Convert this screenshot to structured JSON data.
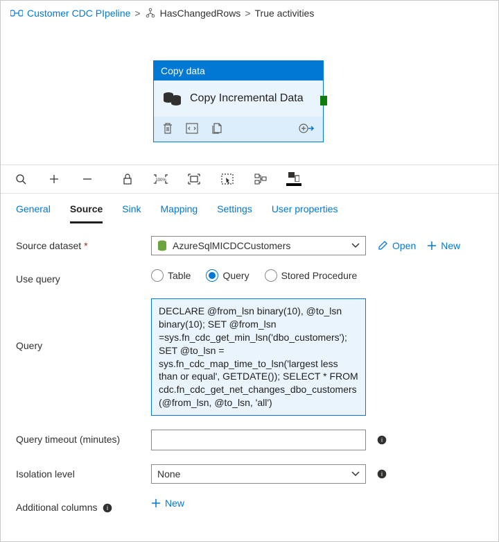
{
  "breadcrumb": {
    "root": "Customer CDC PIpeline",
    "mid": "HasChangedRows",
    "leaf": "True activities"
  },
  "activity": {
    "type": "Copy data",
    "name": "Copy Incremental Data"
  },
  "tabs": [
    "General",
    "Source",
    "Sink",
    "Mapping",
    "Settings",
    "User properties"
  ],
  "form": {
    "sourceDatasetLabel": "Source dataset",
    "sourceDatasetValue": "AzureSqlMICDCCustomers",
    "openLabel": "Open",
    "newLabel": "New",
    "useQueryLabel": "Use query",
    "useQueryOptions": {
      "table": "Table",
      "query": "Query",
      "sproc": "Stored Procedure"
    },
    "queryLabel": "Query",
    "queryValue": "DECLARE @from_lsn binary(10), @to_lsn binary(10); SET @from_lsn =sys.fn_cdc_get_min_lsn('dbo_customers'); SET @to_lsn = sys.fn_cdc_map_time_to_lsn('largest less than or equal', GETDATE()); SELECT * FROM cdc.fn_cdc_get_net_changes_dbo_customers(@from_lsn, @to_lsn, 'all')",
    "timeoutLabel": "Query timeout (minutes)",
    "timeoutValue": "",
    "isolationLabel": "Isolation level",
    "isolationValue": "None",
    "addColsLabel": "Additional columns",
    "addColsNew": "New"
  }
}
